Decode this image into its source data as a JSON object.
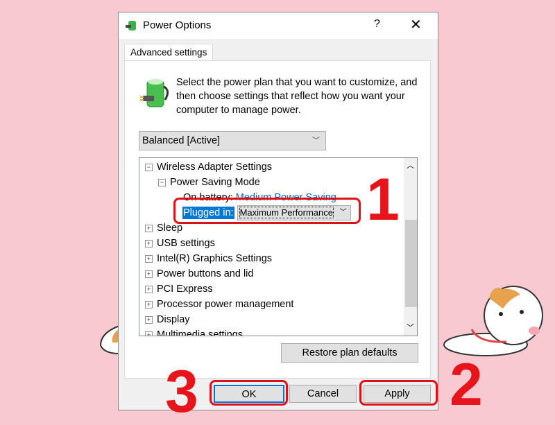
{
  "window": {
    "title": "Power Options",
    "help": "?",
    "close": "✕"
  },
  "tab": "Advanced settings",
  "description": "Select the power plan that you want to customize, and then choose settings that reflect how you want your computer to manage power.",
  "plan_select": "Balanced [Active]",
  "tree": {
    "wireless": "Wireless Adapter Settings",
    "psm": "Power Saving Mode",
    "on_battery_label": "On battery:",
    "on_battery_value": "Medium Power Saving",
    "plugged_label": "Plugged in:",
    "plugged_value": "Maximum Performance",
    "items": [
      "Sleep",
      "USB settings",
      "Intel(R) Graphics Settings",
      "Power buttons and lid",
      "PCI Express",
      "Processor power management",
      "Display",
      "Multimedia settings"
    ]
  },
  "buttons": {
    "restore": "Restore plan defaults",
    "ok": "OK",
    "cancel": "Cancel",
    "apply": "Apply"
  },
  "annotations": [
    "1",
    "2",
    "3"
  ],
  "colors": {
    "background": "#f9c9d1",
    "annotation": "#e8141c",
    "selection": "#0078d7",
    "link": "#0066cc"
  }
}
